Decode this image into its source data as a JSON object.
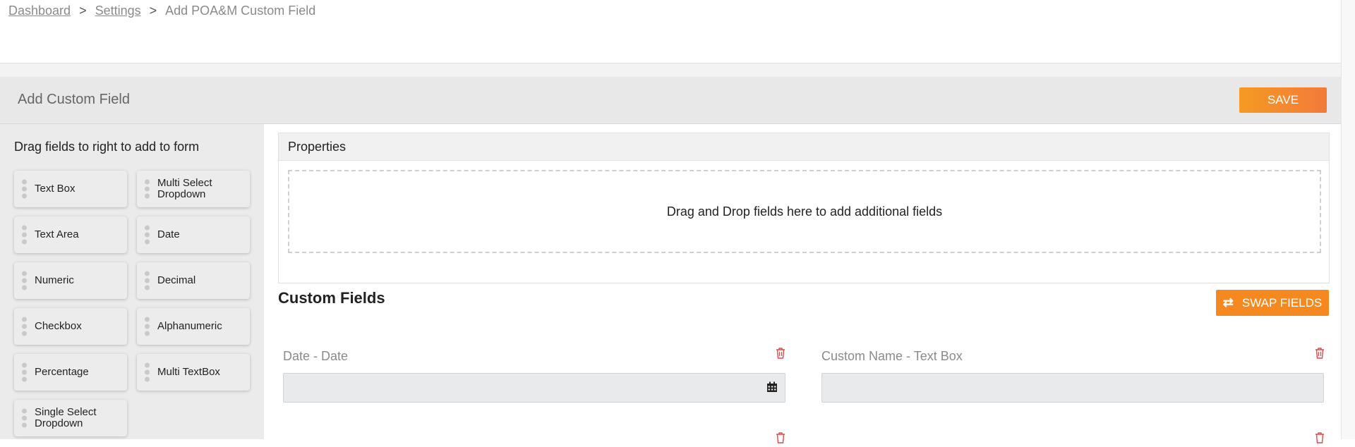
{
  "breadcrumb": {
    "items": [
      "Dashboard",
      "Settings"
    ],
    "current": "Add POA&M Custom Field",
    "separator": ">"
  },
  "header": {
    "title": "Add Custom Field",
    "save_label": "SAVE"
  },
  "palette": {
    "hint": "Drag fields to right to add to form",
    "fields": [
      "Text Box",
      "Multi Select Dropdown",
      "Text Area",
      "Date",
      "Numeric",
      "Decimal",
      "Checkbox",
      "Alphanumeric",
      "Percentage",
      "Multi TextBox",
      "Single Select Dropdown"
    ]
  },
  "properties": {
    "title": "Properties",
    "dropzone_text": "Drag and Drop fields here to add additional fields"
  },
  "custom_fields": {
    "title": "Custom Fields",
    "swap_label": "SWAP FIELDS",
    "items": [
      {
        "label": "Date - Date",
        "value": ""
      },
      {
        "label": "Custom Name - Text Box",
        "value": ""
      }
    ]
  },
  "icons": [
    "drag-grip-icon",
    "trash-icon",
    "calendar-icon",
    "swap-arrows-icon"
  ],
  "colors": {
    "accent": "#f5891f",
    "delete": "#e04848"
  }
}
